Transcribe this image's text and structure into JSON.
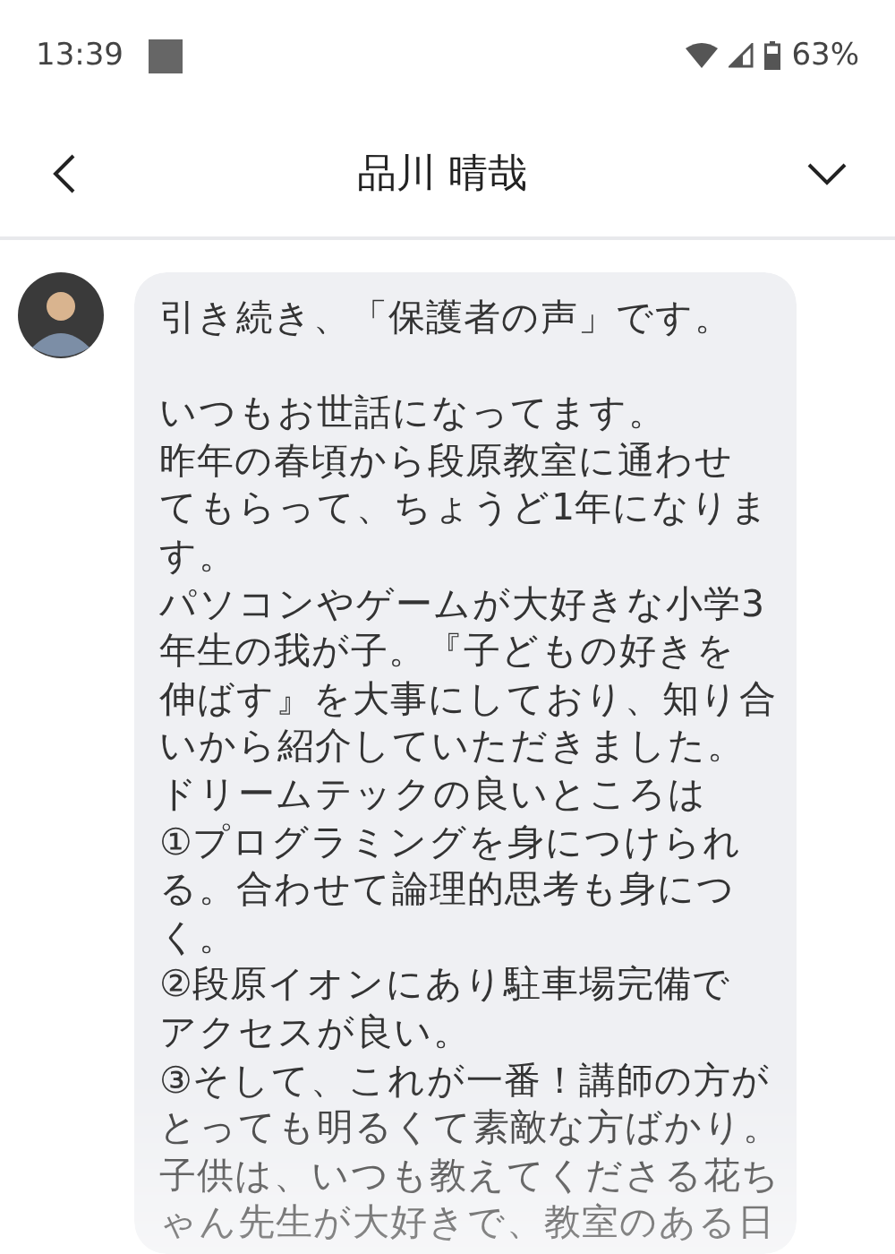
{
  "status_bar": {
    "time": "13:39",
    "battery": "63%"
  },
  "header": {
    "title": "品川 晴哉"
  },
  "messages": [
    {
      "paragraphs": [
        [
          "引き続き、「保護者の声」です。"
        ],
        [
          "いつもお世話になってます。",
          "昨年の春頃から段原教室に通わせ",
          "てもらって、ちょうど1年になりま",
          "す。",
          "パソコンやゲームが大好きな小学3",
          "年生の我が子。『子どもの好きを",
          "伸ばす』を大事にしており、知り合",
          "いから紹介していただきました。",
          "ドリームテックの良いところは",
          "①プログラミングを身につけられ",
          "る。合わせて論理的思考も身につ",
          "く。",
          "②段原イオンにあり駐車場完備で",
          "アクセスが良い。",
          "③そして、これが一番！講師の方が",
          "とっても明るくて素敵な方ばかり。",
          "子供は、いつも教えてくださる花ち",
          "ゃん先生が大好きで、教室のある日"
        ]
      ]
    }
  ]
}
